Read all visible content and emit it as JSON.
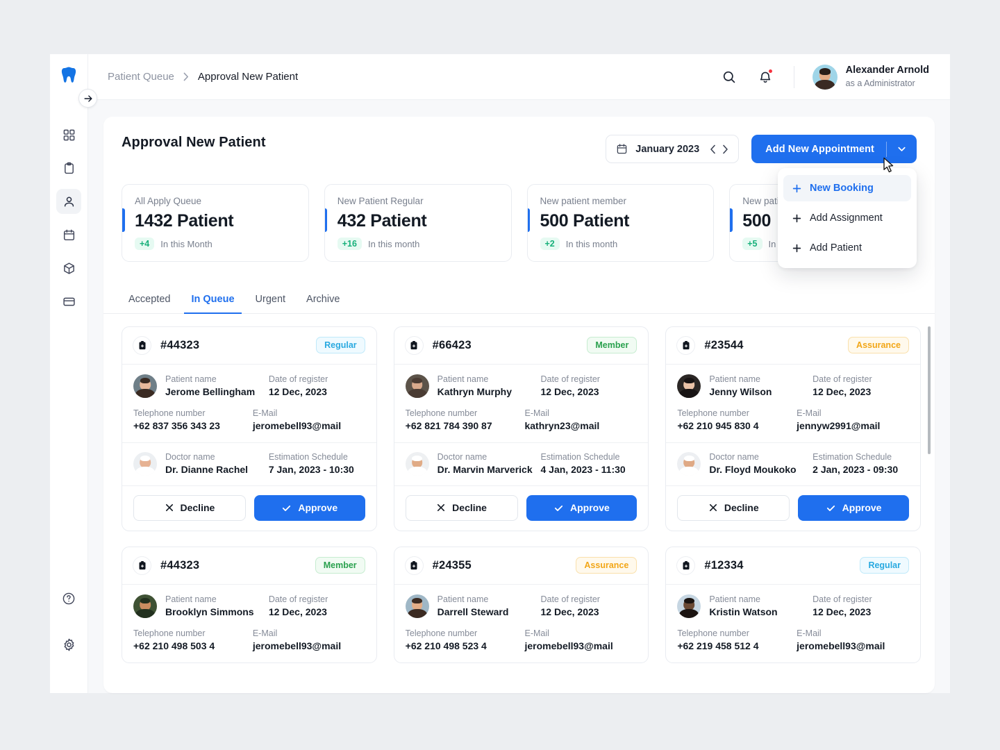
{
  "brand": {
    "logo_icon": "tooth-icon",
    "accent": "#1f6fee"
  },
  "sidebar": {
    "collapse_icon": "arrow-right-icon",
    "items": [
      {
        "icon": "grid-dashboard-icon",
        "active": false
      },
      {
        "icon": "clipboard-icon",
        "active": false
      },
      {
        "icon": "user-icon",
        "active": true
      },
      {
        "icon": "calendar-icon",
        "active": false
      },
      {
        "icon": "box-package-icon",
        "active": false
      },
      {
        "icon": "credit-card-icon",
        "active": false
      }
    ],
    "bottom_items": [
      {
        "icon": "help-circle-icon"
      },
      {
        "icon": "gear-icon"
      }
    ]
  },
  "topbar": {
    "breadcrumb": {
      "parent": "Patient Queue",
      "separator": "›",
      "current": "Approval New Patient"
    },
    "search_icon": "search-icon",
    "notification_icon": "bell-icon",
    "user": {
      "name": "Alexander Arnold",
      "role": "as a Administrator",
      "avatar": "avatar"
    }
  },
  "page": {
    "title": "Approval New Patient",
    "date_picker": {
      "icon": "calendar-icon",
      "label": "January 2023",
      "prev_icon": "chevron-left-icon",
      "next_icon": "chevron-right-icon"
    },
    "add_button": {
      "label": "Add New  Appointment",
      "caret_icon": "chevron-down-icon"
    },
    "dropdown": {
      "items": [
        {
          "label": "New Booking",
          "icon": "plus-icon",
          "active": true
        },
        {
          "label": "Add Assignment",
          "icon": "plus-icon",
          "active": false
        },
        {
          "label": "Add Patient",
          "icon": "plus-icon",
          "active": false
        }
      ]
    }
  },
  "stats": [
    {
      "label": "All Apply Queue",
      "value": "1432 Patient",
      "delta": "+4",
      "period": "In this Month"
    },
    {
      "label": "New Patient Regular",
      "value": "432 Patient",
      "delta": "+16",
      "period": "In this month"
    },
    {
      "label": "New patient member",
      "value": "500 Patient",
      "delta": "+2",
      "period": "In this month"
    },
    {
      "label": "New patient",
      "value": "500",
      "delta": "+5",
      "period": "In this month"
    }
  ],
  "tabs": [
    {
      "label": "Accepted",
      "active": false
    },
    {
      "label": "In Queue",
      "active": true
    },
    {
      "label": "Urgent",
      "active": false
    },
    {
      "label": "Archive",
      "active": false
    }
  ],
  "field_labels": {
    "patient_name": "Patient name",
    "date_of_register": "Date of register",
    "telephone": "Telephone number",
    "email": "E-Mail",
    "doctor_name": "Doctor name",
    "estimation_schedule": "Estimation Schedule"
  },
  "actions": {
    "decline": "Decline",
    "approve": "Approve",
    "decline_icon": "close-icon",
    "approve_icon": "check-icon"
  },
  "cards": [
    {
      "id": "#44323",
      "badge": "Regular",
      "badge_type": "regular",
      "patient_name": "Jerome Bellingham",
      "date_of_register": "12 Dec, 2023",
      "telephone": "+62 837 356 343 23",
      "email": "jeromebell93@mail",
      "doctor_name": "Dr. Dianne Rachel",
      "estimation_schedule": "7 Jan, 2023 - 10:30",
      "avatar_skin": "#e8b89b",
      "avatar_hair": "#3a2a22",
      "avatar_bg": "#6f7f88",
      "doctor_skin": "#e6b293",
      "doctor_hair": "#2a2020",
      "doctor_bg": "#eceff2",
      "has_actions": true
    },
    {
      "id": "#66423",
      "badge": "Member",
      "badge_type": "member",
      "patient_name": "Kathryn Murphy",
      "date_of_register": "12 Dec, 2023",
      "telephone": "+62 821 784 390 87",
      "email": "kathryn23@mail",
      "doctor_name": "Dr. Marvin Marverick",
      "estimation_schedule": "4 Jan, 2023 - 11:30",
      "avatar_skin": "#d8a98c",
      "avatar_hair": "#4a3b33",
      "avatar_bg": "#5c5349",
      "doctor_skin": "#e0ab86",
      "doctor_hair": "#33261e",
      "doctor_bg": "#eef0f2",
      "has_actions": true
    },
    {
      "id": "#23544",
      "badge": "Assurance",
      "badge_type": "assurance",
      "patient_name": "Jenny Wilson",
      "date_of_register": "12 Dec, 2023",
      "telephone": "+62 210 945 830 4",
      "email": "jennyw2991@mail",
      "doctor_name": "Dr. Floyd Moukoko",
      "estimation_schedule": "2 Jan, 2023 - 09:30",
      "avatar_skin": "#eac3a8",
      "avatar_hair": "#181414",
      "avatar_bg": "#2b2725",
      "doctor_skin": "#dfa985",
      "doctor_hair": "#2c211b",
      "doctor_bg": "#edeff2",
      "has_actions": true
    },
    {
      "id": "#44323",
      "badge": "Member",
      "badge_type": "member",
      "patient_name": "Brooklyn Simmons",
      "date_of_register": "12 Dec, 2023",
      "telephone": "+62 210 498 503 4",
      "email": "jeromebell93@mail",
      "doctor_name": "",
      "estimation_schedule": "",
      "avatar_skin": "#c98c60",
      "avatar_hair": "#22301e",
      "avatar_bg": "#3f5234",
      "doctor_skin": "",
      "doctor_hair": "",
      "doctor_bg": "",
      "has_actions": false
    },
    {
      "id": "#24355",
      "badge": "Assurance",
      "badge_type": "assurance",
      "patient_name": "Darrell Steward",
      "date_of_register": "12 Dec, 2023",
      "telephone": "+62 210 498 523 4",
      "email": "jeromebell93@mail",
      "doctor_name": "",
      "estimation_schedule": "",
      "avatar_skin": "#e3ad87",
      "avatar_hair": "#3b2a21",
      "avatar_bg": "#9fb7c6",
      "doctor_skin": "",
      "doctor_hair": "",
      "doctor_bg": "",
      "has_actions": false
    },
    {
      "id": "#12334",
      "badge": "Regular",
      "badge_type": "regular",
      "patient_name": "Kristin Watson",
      "date_of_register": "12 Dec, 2023",
      "telephone": "+62 219 458 512 4",
      "email": "jeromebell93@mail",
      "doctor_name": "",
      "estimation_schedule": "",
      "avatar_skin": "#6b4a35",
      "avatar_hair": "#1b1411",
      "avatar_bg": "#c6d6e2",
      "doctor_skin": "",
      "doctor_hair": "",
      "doctor_bg": "",
      "has_actions": false
    }
  ]
}
